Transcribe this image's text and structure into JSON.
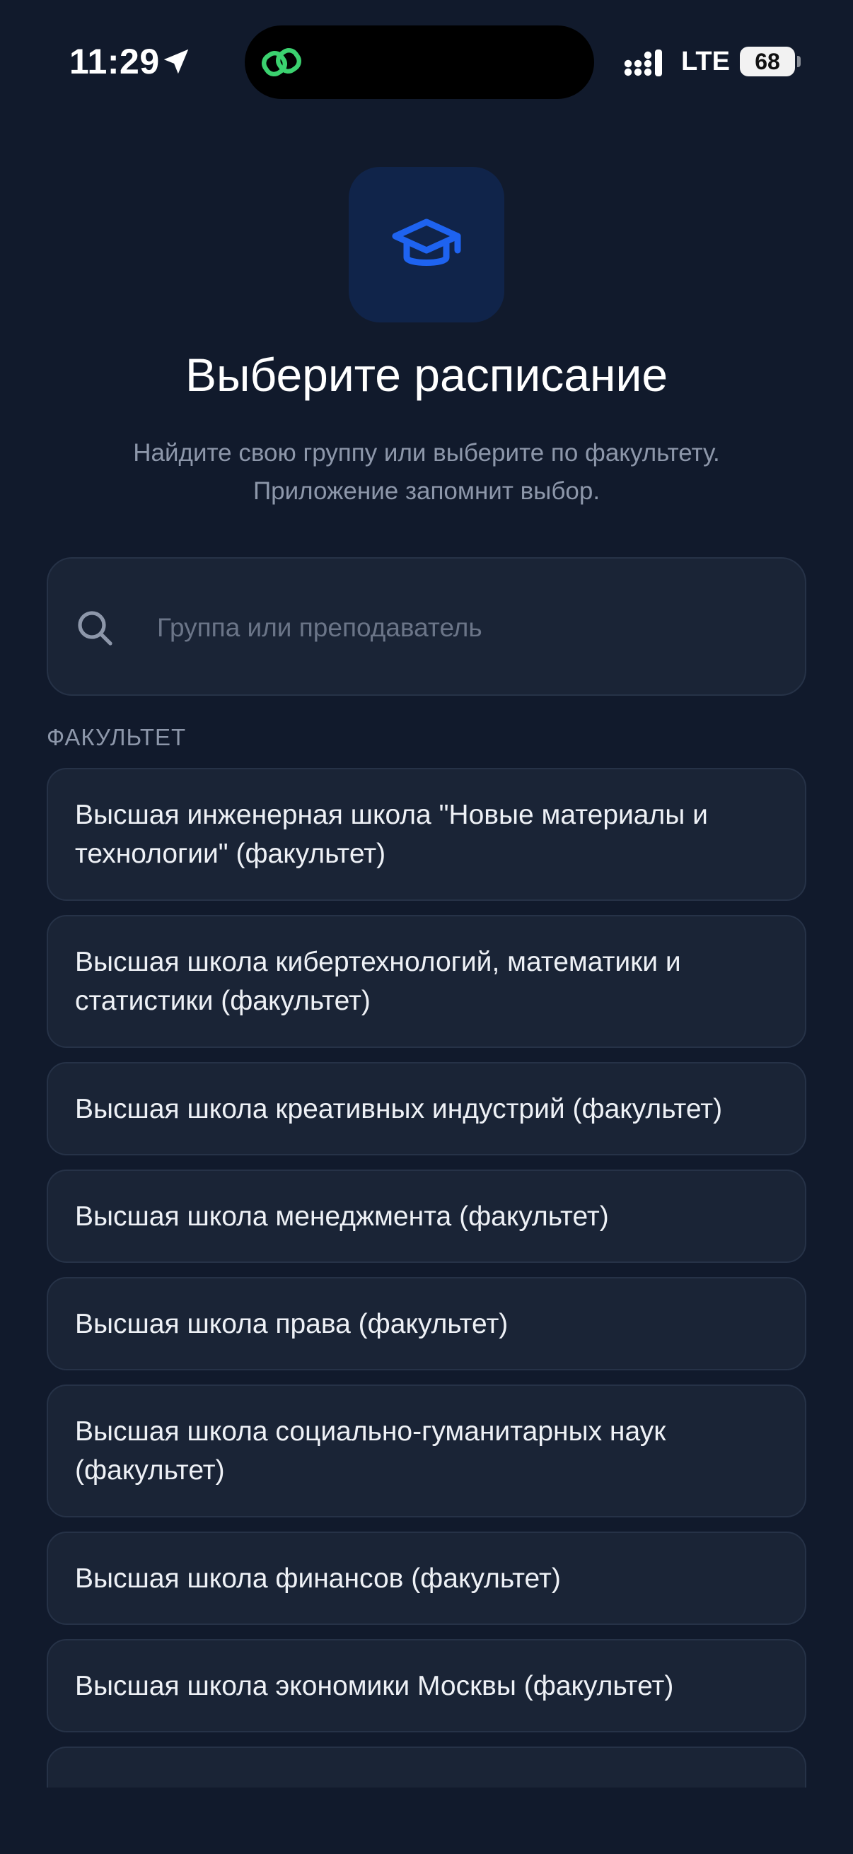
{
  "status_bar": {
    "time": "11:29",
    "network": "LTE",
    "battery": "68"
  },
  "header": {
    "title": "Выберите расписание",
    "subtitle_line1": "Найдите свою группу или выберите по факультету.",
    "subtitle_line2": "Приложение запомнит выбор."
  },
  "search": {
    "placeholder": "Группа или преподаватель",
    "value": ""
  },
  "section_label": "ФАКУЛЬТЕТ",
  "faculties": [
    "Высшая инженерная школа \"Новые материалы и технологии\" (факультет)",
    "Высшая школа кибертехнологий, математики и статистики (факультет)",
    "Высшая школа креативных индустрий (факультет)",
    "Высшая школа менеджмента (факультет)",
    "Высшая школа права (факультет)",
    "Высшая школа социально-гуманитарных наук (факультет)",
    "Высшая школа финансов (факультет)",
    "Высшая школа экономики Москвы (факультет)"
  ],
  "colors": {
    "background": "#111a2c",
    "card": "#1a2436",
    "accent": "#1e63f0",
    "island_app": "#3bd16f"
  },
  "icons": {
    "logo": "graduation-cap-icon",
    "search": "search-icon",
    "location": "location-arrow-icon"
  }
}
